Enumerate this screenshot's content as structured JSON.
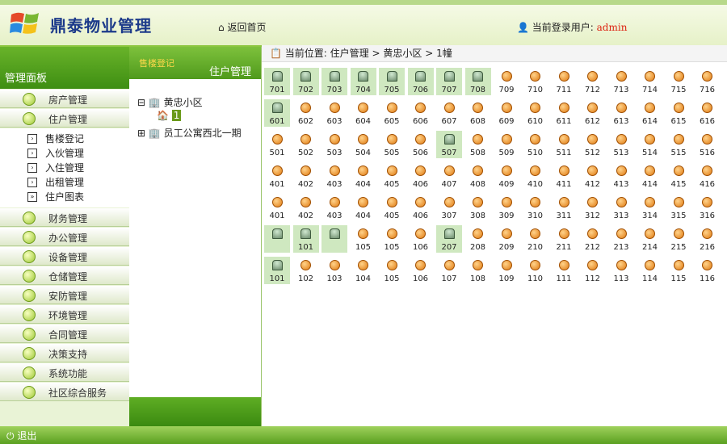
{
  "header": {
    "title": "鼎泰物业管理",
    "home_link": "返回首页",
    "user_label": "当前登录用户:",
    "username": "admin"
  },
  "sidebar": {
    "title": "管理面板",
    "items_top": [
      {
        "label": "房产管理"
      },
      {
        "label": "住户管理"
      }
    ],
    "submenu": [
      {
        "label": "售楼登记"
      },
      {
        "label": "入伙管理"
      },
      {
        "label": "入住管理"
      },
      {
        "label": "出租管理"
      },
      {
        "label": "住户图表"
      }
    ],
    "items_bottom": [
      {
        "label": "财务管理"
      },
      {
        "label": "办公管理"
      },
      {
        "label": "设备管理"
      },
      {
        "label": "仓储管理"
      },
      {
        "label": "安防管理"
      },
      {
        "label": "环境管理"
      },
      {
        "label": "合同管理"
      },
      {
        "label": "决策支持"
      },
      {
        "label": "系统功能"
      },
      {
        "label": "社区综合服务"
      }
    ]
  },
  "tree_panel": {
    "tab_left": "售楼登记",
    "tab_right": "住户管理",
    "nodes": [
      "黄忠小区",
      "1",
      "员工公寓西北一期"
    ]
  },
  "breadcrumb": {
    "prefix": "当前位置:",
    "crumbs": [
      "住户管理",
      "黄忠小区",
      "1幢"
    ]
  },
  "rooms": [
    {
      "floor": "7",
      "units": [
        "701",
        "702",
        "703",
        "704",
        "705",
        "706",
        "707",
        "708",
        "709",
        "710",
        "711",
        "712",
        "713",
        "714",
        "715",
        "716"
      ],
      "occupied": [
        0,
        1,
        2,
        3,
        4,
        5,
        6,
        7
      ]
    },
    {
      "floor": "6",
      "units": [
        "601",
        "602",
        "603",
        "604",
        "605",
        "606",
        "607",
        "608",
        "609",
        "610",
        "611",
        "612",
        "613",
        "614",
        "615",
        "616"
      ],
      "occupied": [
        0
      ]
    },
    {
      "floor": "5",
      "units": [
        "501",
        "502",
        "503",
        "504",
        "505",
        "506",
        "507",
        "508",
        "509",
        "510",
        "511",
        "512",
        "513",
        "514",
        "515",
        "516"
      ],
      "occupied": [
        6
      ]
    },
    {
      "floor": "4",
      "units": [
        "401",
        "402",
        "403",
        "404",
        "405",
        "406",
        "407",
        "408",
        "409",
        "410",
        "411",
        "412",
        "413",
        "414",
        "415",
        "416"
      ],
      "occupied": []
    },
    {
      "floor": "3",
      "units": [
        "401",
        "402",
        "403",
        "404",
        "405",
        "406",
        "307",
        "308",
        "309",
        "310",
        "311",
        "312",
        "313",
        "314",
        "315",
        "316"
      ],
      "occupied": []
    },
    {
      "floor": "2",
      "units": [
        "",
        "101",
        "",
        "105",
        "105",
        "106",
        "207",
        "208",
        "209",
        "210",
        "211",
        "212",
        "213",
        "214",
        "215",
        "216"
      ],
      "occupied": [
        0,
        1,
        2,
        6
      ]
    },
    {
      "floor": "1",
      "units": [
        "101",
        "102",
        "103",
        "104",
        "105",
        "106",
        "107",
        "108",
        "109",
        "110",
        "111",
        "112",
        "113",
        "114",
        "115",
        "116"
      ],
      "occupied": [
        0
      ]
    }
  ],
  "footer": {
    "exit_label": "退出"
  }
}
